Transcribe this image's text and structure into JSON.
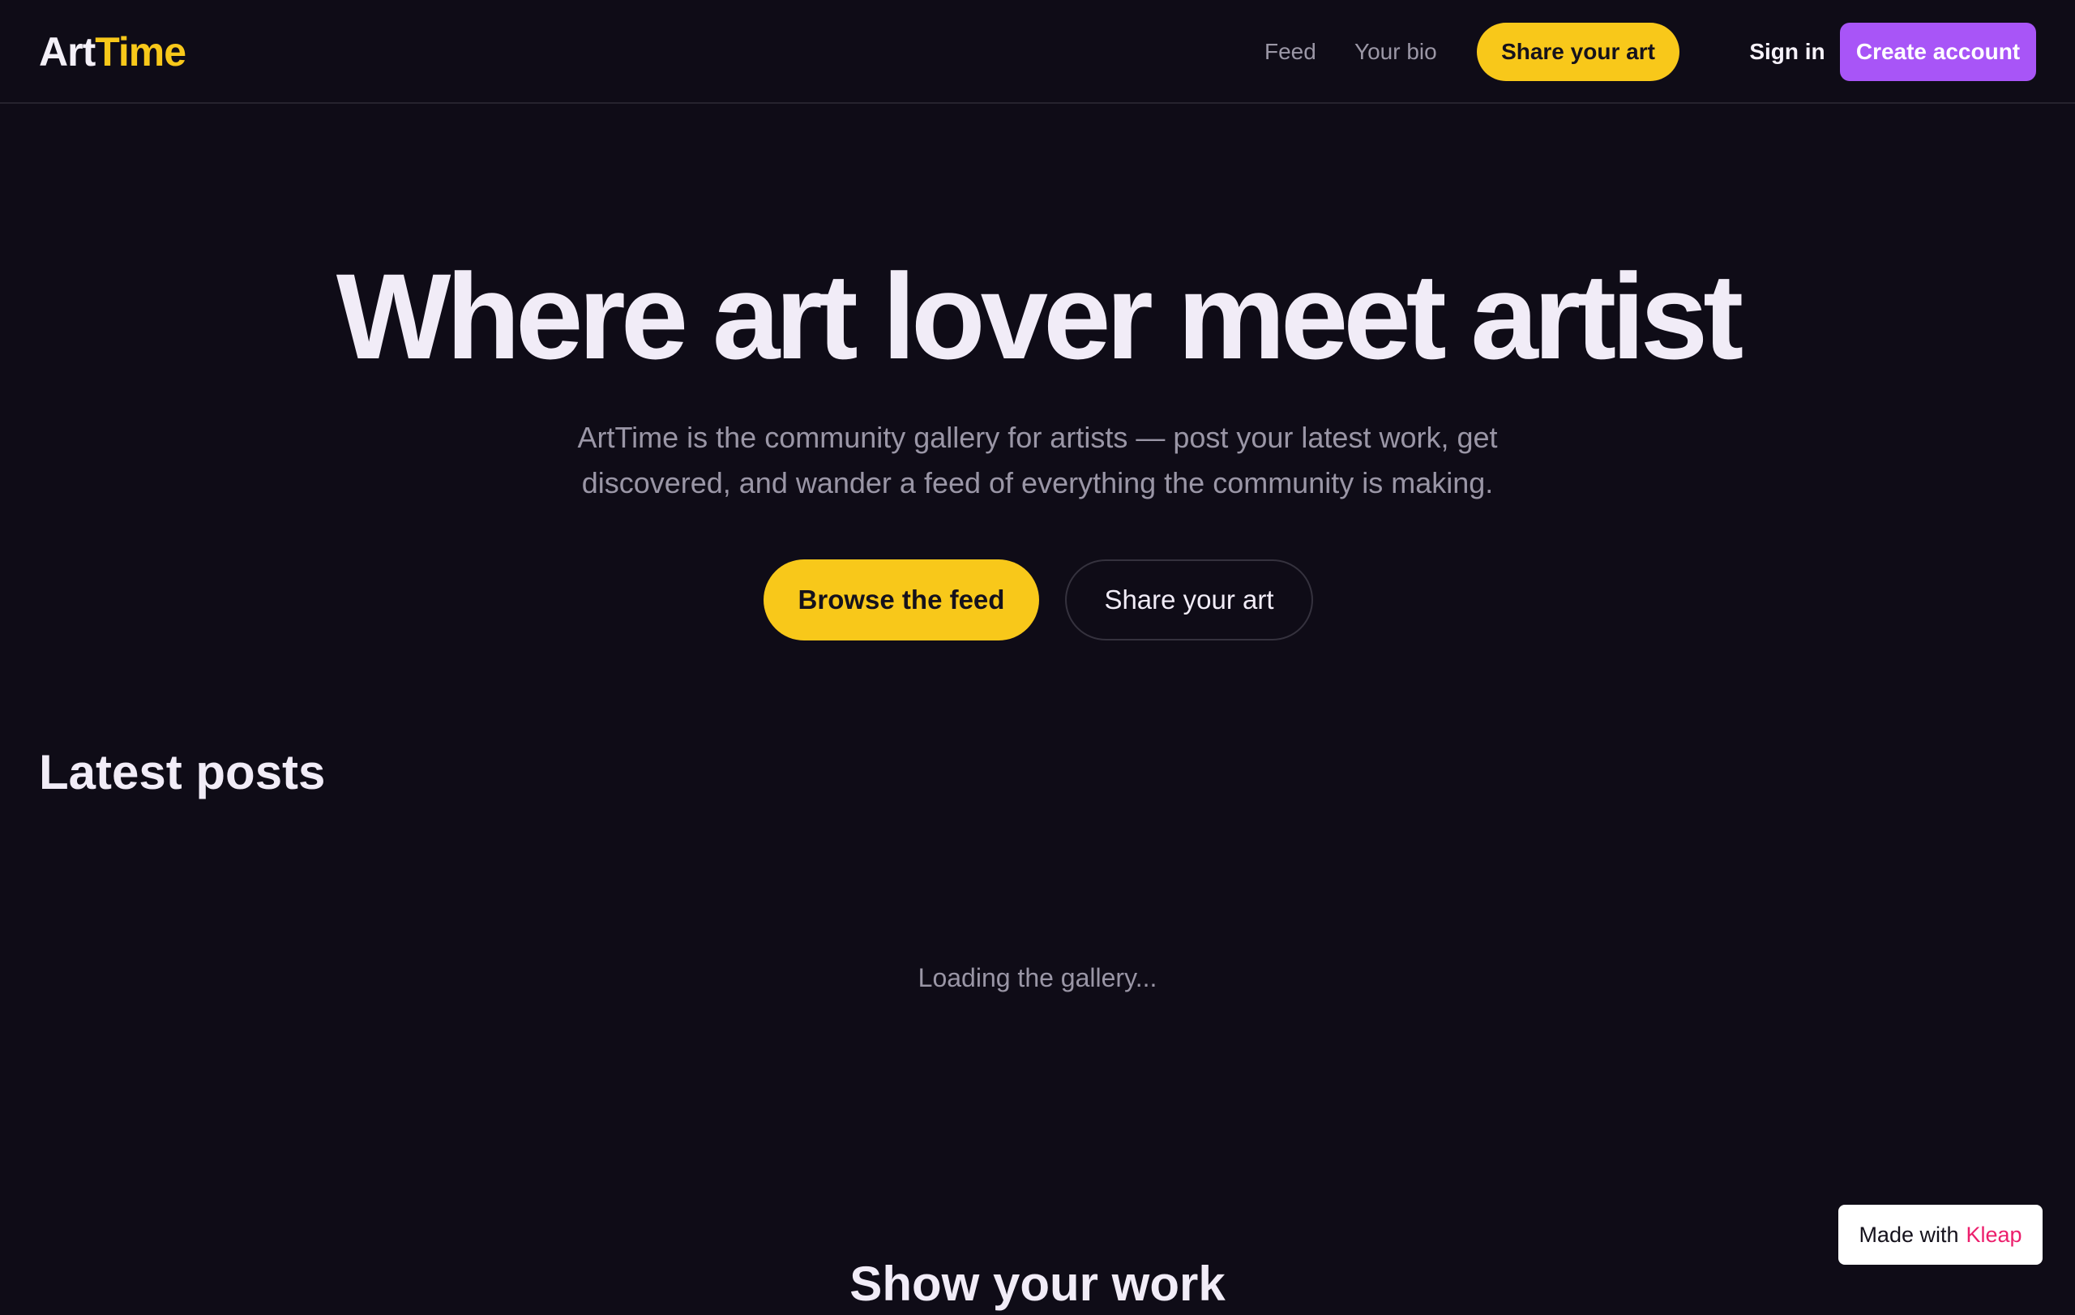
{
  "header": {
    "logo_part1": "Art",
    "logo_part2": "Time",
    "nav": {
      "feed": "Feed",
      "bio": "Your bio"
    },
    "share_button": "Share your art",
    "sign_in": "Sign in",
    "create_account": "Create account"
  },
  "hero": {
    "title": "Where art lover meet artist",
    "subtitle_line1": "ArtTime is the community gallery for artists — post your latest work, get",
    "subtitle_line2": "discovered, and wander a feed of everything the community is making.",
    "primary_cta": "Browse the feed",
    "secondary_cta": "Share your art"
  },
  "latest": {
    "title": "Latest posts",
    "loading": "Loading the gallery..."
  },
  "show_work": {
    "title": "Show your work"
  },
  "badge": {
    "prefix": "Made with",
    "brand": "Kleap"
  },
  "colors": {
    "background": "#0f0c17",
    "accent_yellow": "#f8c81a",
    "accent_purple": "#a855f7",
    "brand_pink": "#ec1e6c"
  }
}
